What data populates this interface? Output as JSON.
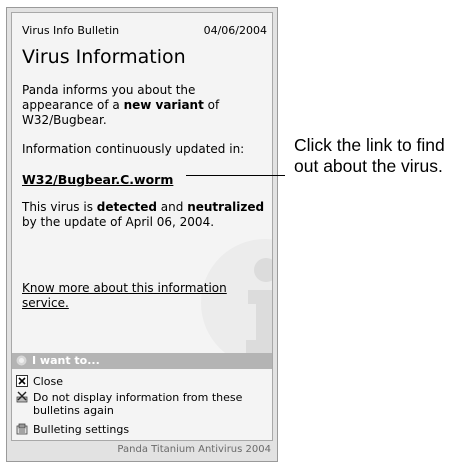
{
  "bulletin": {
    "app_name": "Virus Info Bulletin",
    "date": "04/06/2004",
    "title": "Virus Information",
    "intro_1": "Panda informs you about the appearance of a ",
    "intro_bold": "new variant",
    "intro_2": " of W32/Bugbear.",
    "updated_text": "Information continuously updated in:",
    "virus_link": "W32/Bugbear.C.worm",
    "status_1": "This virus is ",
    "status_bold_1": "detected",
    "status_2": " and ",
    "status_bold_2": "neutralized",
    "status_3": " by the update of April 06, 2004.",
    "more_link": "Know more about this information service.",
    "watermark_icon": "info-icon"
  },
  "actions": {
    "header": "I want to...",
    "items": [
      {
        "label": "Close",
        "icon": "close-icon"
      },
      {
        "label": "Do not display information from these bulletins again",
        "icon": "do-not-display-icon"
      },
      {
        "label": "Bulleting settings",
        "icon": "settings-icon"
      }
    ]
  },
  "footer": "Panda Titanium Antivirus 2004",
  "callout": "Click the link to find out about the virus.",
  "colors": {
    "panel": "#f4f4f4",
    "bar": "#b4b4b4",
    "frame": "#e2e2e2"
  }
}
